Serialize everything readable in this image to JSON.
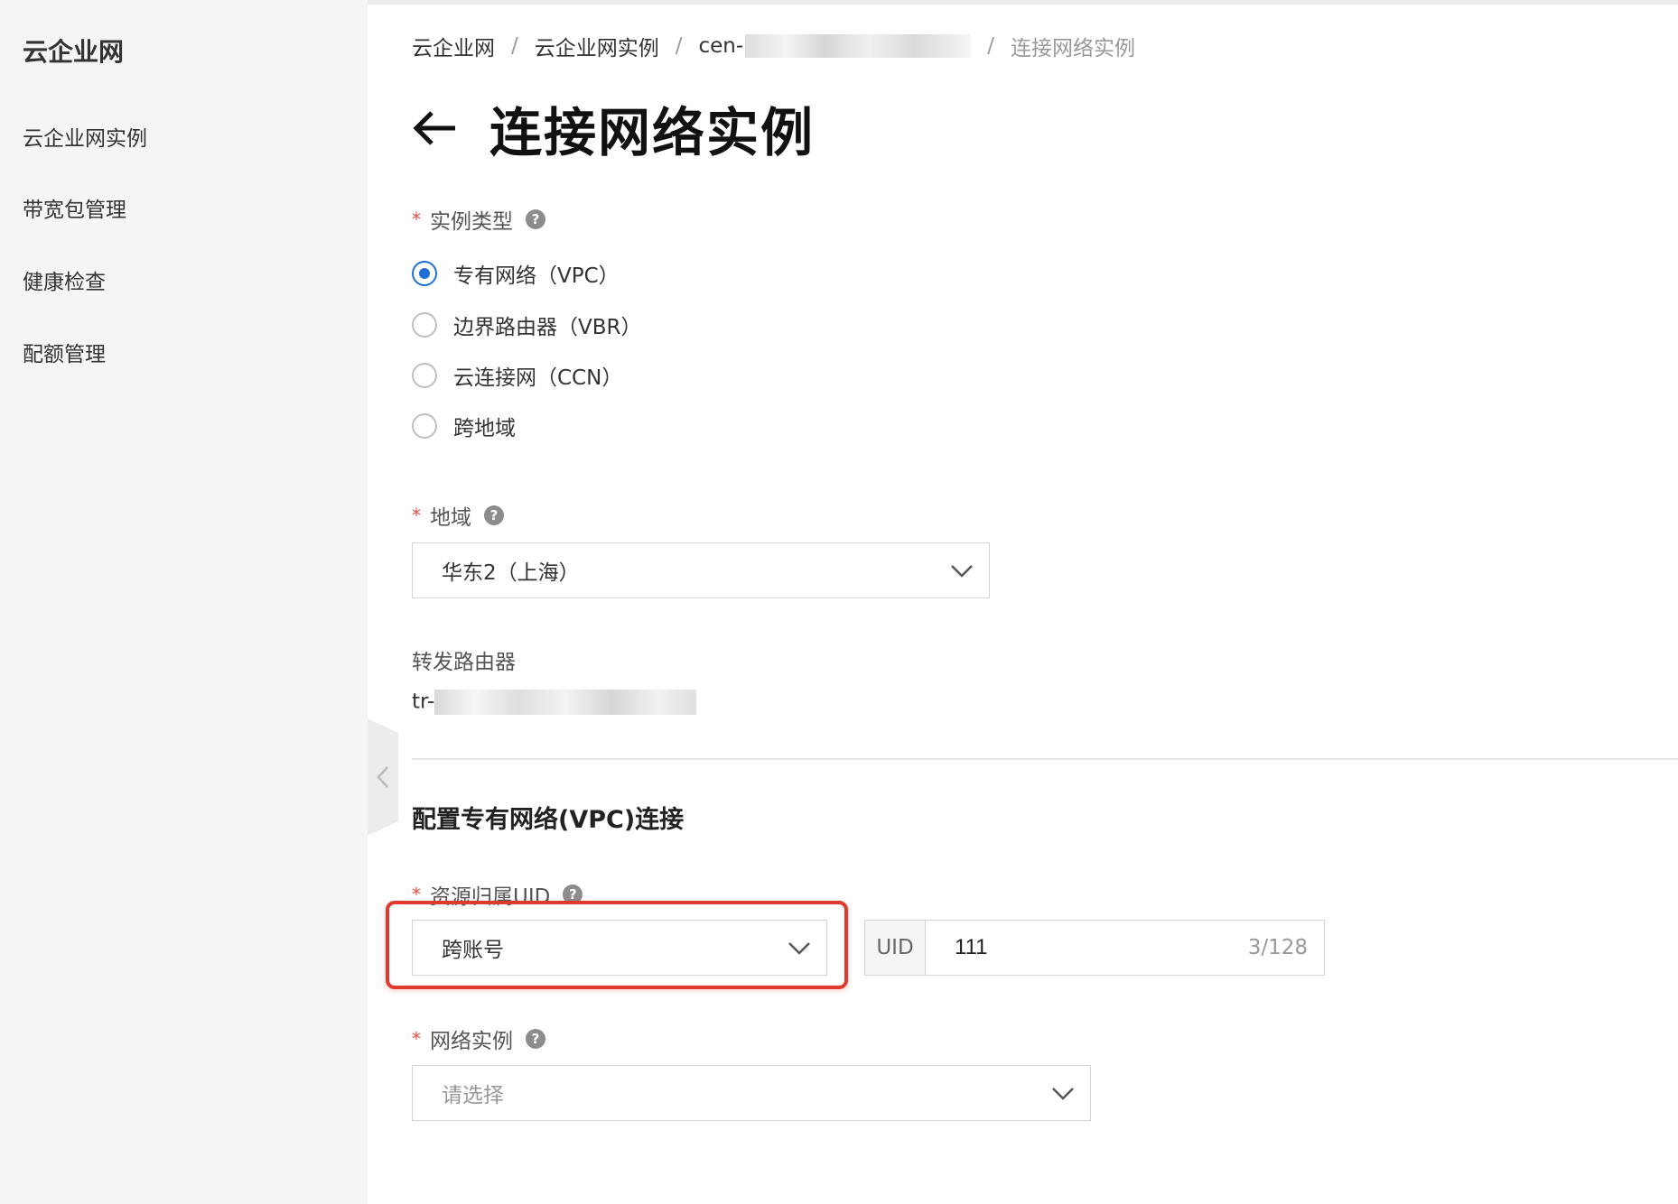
{
  "sidebar": {
    "title": "云企业网",
    "items": [
      {
        "label": "云企业网实例"
      },
      {
        "label": "带宽包管理"
      },
      {
        "label": "健康检查"
      },
      {
        "label": "配额管理"
      }
    ]
  },
  "breadcrumb": {
    "items": [
      "云企业网",
      "云企业网实例",
      "cen-"
    ],
    "current": "连接网络实例",
    "separator": "/"
  },
  "page": {
    "title": "连接网络实例"
  },
  "form": {
    "instance_type": {
      "label": "实例类型",
      "options": [
        "专有网络（VPC）",
        "边界路由器（VBR）",
        "云连接网（CCN）",
        "跨地域"
      ],
      "selected": "专有网络（VPC）"
    },
    "region": {
      "label": "地域",
      "value": "华东2（上海）"
    },
    "transit_router": {
      "label": "转发路由器",
      "value_prefix": "tr-"
    },
    "vpc_section": {
      "title": "配置专有网络(VPC)连接"
    },
    "resource_uid": {
      "label": "资源归属UID",
      "account_type": "跨账号",
      "uid_addon": "UID",
      "uid_value": "111",
      "uid_count": "3/128"
    },
    "network_instance": {
      "label": "网络实例",
      "placeholder": "请选择"
    }
  },
  "colors": {
    "accent": "#1f6fd6",
    "required": "#e54d42",
    "highlight": "#e03a2f"
  }
}
